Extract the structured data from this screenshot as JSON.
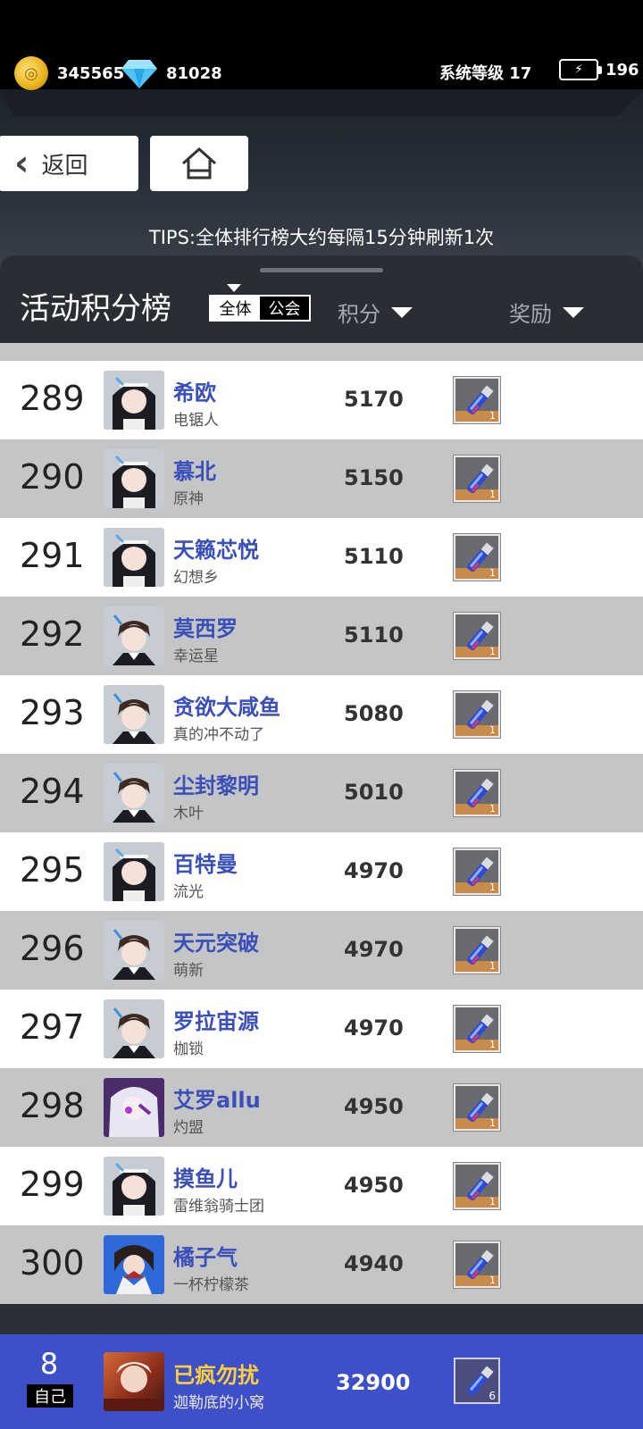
{
  "status": {
    "coins": "345565",
    "gems": "81028",
    "system_level": "系统等级 17",
    "energy": "196"
  },
  "nav": {
    "back_label": "返回"
  },
  "tips": "TIPS:全体排行榜大约每隔15分钟刷新1次",
  "panel": {
    "title": "活动积分榜",
    "scope_all": "全体",
    "scope_guild": "公会",
    "col_score": "积分",
    "col_reward": "奖励"
  },
  "rows": [
    {
      "rank": "289",
      "name": "希欧",
      "sub": "电锯人",
      "score": "5170",
      "qty": "1",
      "avatar": "girl"
    },
    {
      "rank": "290",
      "name": "慕北",
      "sub": "原神",
      "score": "5150",
      "qty": "1",
      "avatar": "girl"
    },
    {
      "rank": "291",
      "name": "天籁芯悦",
      "sub": "幻想乡",
      "score": "5110",
      "qty": "1",
      "avatar": "girl"
    },
    {
      "rank": "292",
      "name": "莫西罗",
      "sub": "幸运星",
      "score": "5110",
      "qty": "1",
      "avatar": "boy"
    },
    {
      "rank": "293",
      "name": "贪欲大咸鱼",
      "sub": "真的冲不动了",
      "score": "5080",
      "qty": "1",
      "avatar": "boy"
    },
    {
      "rank": "294",
      "name": "尘封黎明",
      "sub": "木叶",
      "score": "5010",
      "qty": "1",
      "avatar": "boy"
    },
    {
      "rank": "295",
      "name": "百特曼",
      "sub": "流光",
      "score": "4970",
      "qty": "1",
      "avatar": "girl"
    },
    {
      "rank": "296",
      "name": "天元突破",
      "sub": "萌新",
      "score": "4970",
      "qty": "1",
      "avatar": "boy"
    },
    {
      "rank": "297",
      "name": "罗拉宙源",
      "sub": "枷锁",
      "score": "4970",
      "qty": "1",
      "avatar": "boy"
    },
    {
      "rank": "298",
      "name": "艾罗allu",
      "sub": "灼盟",
      "score": "4950",
      "qty": "1",
      "avatar": "white"
    },
    {
      "rank": "299",
      "name": "摸鱼儿",
      "sub": "雷维翁骑士团",
      "score": "4950",
      "qty": "1",
      "avatar": "girl"
    },
    {
      "rank": "300",
      "name": "橘子气",
      "sub": "一杯柠檬茶",
      "score": "4940",
      "qty": "1",
      "avatar": "fan"
    }
  ],
  "self": {
    "rank": "8",
    "tag": "自己",
    "name": "已疯勿扰",
    "sub": "迦勒底的小窝",
    "score": "32900",
    "qty": "6"
  }
}
